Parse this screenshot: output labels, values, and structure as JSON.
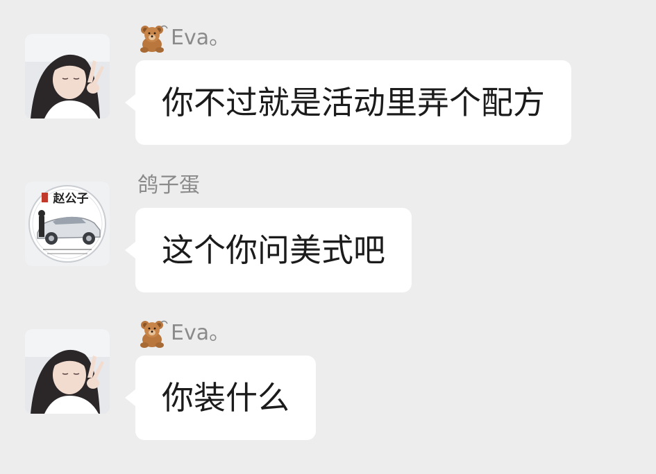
{
  "colors": {
    "background": "#ededed",
    "bubble": "#ffffff",
    "sender_name": "#8a8a8a",
    "message_text": "#1b1b1b"
  },
  "messages": [
    {
      "sender": "Eva。",
      "sender_icon": "teddy-bear-icon",
      "avatar": "girl-peace-sign-photo",
      "text": "你不过就是活动里弄个配方"
    },
    {
      "sender": "鸽子蛋",
      "sender_icon": "",
      "avatar": "car-badge-logo",
      "avatar_badge_text": "赵公子",
      "text": "这个你问美式吧"
    },
    {
      "sender": "Eva。",
      "sender_icon": "teddy-bear-icon",
      "avatar": "girl-peace-sign-photo",
      "text": "你装什么"
    }
  ]
}
